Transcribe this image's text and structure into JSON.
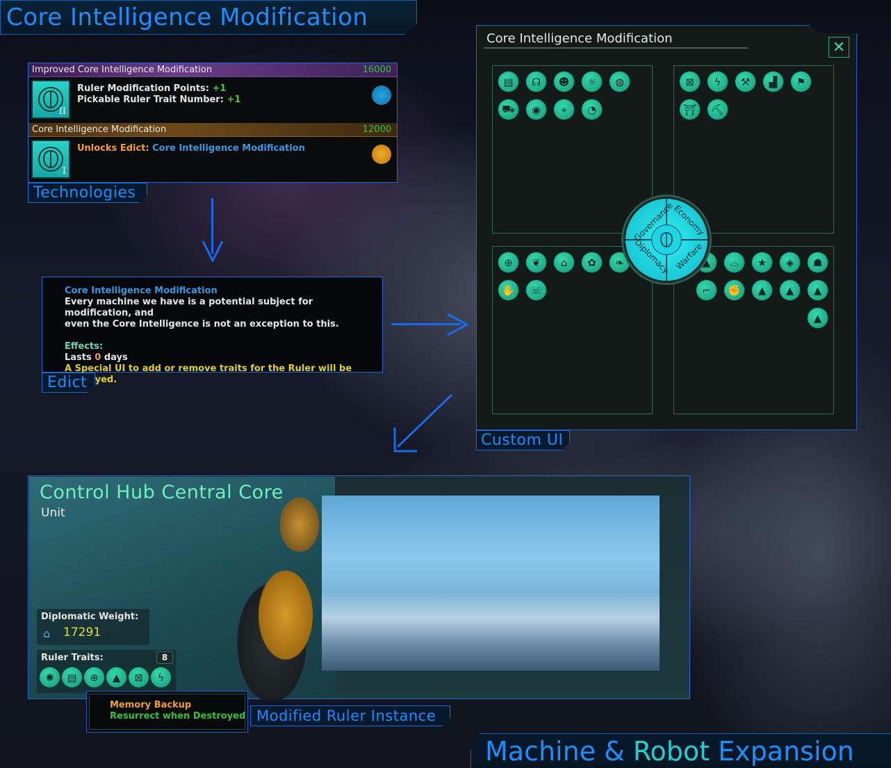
{
  "main_title": "Core Intelligence Modification",
  "technologies": {
    "section_label": "Technologies",
    "items": [
      {
        "name": "Improved Core Intelligence Modification",
        "cost": "16000",
        "tier": "II",
        "effects": [
          {
            "label": "Ruler Modification Points:",
            "value": "+1"
          },
          {
            "label": "Pickable Ruler Trait Number:",
            "value": "+1"
          }
        ],
        "category_icon": "computer-icon",
        "category_color": "#1e8fd0"
      },
      {
        "name": "Core Intelligence Modification",
        "cost": "12000",
        "tier": "I",
        "unlock_label": "Unlocks Edict:",
        "unlock_value": "Core Intelligence Modification",
        "category_icon": "factory-icon",
        "category_color": "#e09a1a"
      }
    ]
  },
  "edict": {
    "section_label": "Edict",
    "title": "Core Intelligence Modification",
    "description_line1": "Every machine we have is a potential subject for modification, and",
    "description_line2": "even the Core Intelligence is not an exception to this.",
    "effects_label": "Effects:",
    "lasts_prefix": "Lasts",
    "lasts_value": "0",
    "lasts_suffix": "days",
    "special_note": "A Special UI to add or remove traits for the Ruler will be displayed."
  },
  "custom_ui": {
    "section_label": "Custom UI",
    "window_title": "Core Intelligence Modification",
    "close_label": "✕",
    "wheel": {
      "governance": "Governance",
      "economy": "Economy",
      "diplomacy": "Diplomacy",
      "warfare": "Warfare"
    },
    "governance_traits": [
      "memory-card-icon",
      "broadcaster-icon",
      "crowd-icon",
      "idea-icon",
      "globe-icon",
      "ore-cart-icon",
      "eye-icon",
      "telescope-icon",
      "gauge-icon"
    ],
    "economy_traits": [
      "construction-icon",
      "energy-icon",
      "pickaxe-icon",
      "factory-icon",
      "flag-planet-icon",
      "tower-icon",
      "mine-cart-icon"
    ],
    "diplomacy_traits": [
      "world-icon",
      "laurel-planet-icon",
      "laurel-bank-icon",
      "laurel-alliance-icon",
      "laurel-fleet-icon",
      "handshake-icon",
      "envoy-icon"
    ],
    "warfare_traits": [
      "fleet-repair-icon",
      "bunker-icon",
      "medal-icon",
      "shield-cube-icon",
      "admiral-icon",
      "boot-icon",
      "fist-icon",
      "ship-1-icon",
      "ship-2-icon",
      "ship-3-icon",
      "ship-4-icon"
    ]
  },
  "ruler_card": {
    "section_label": "Modified Ruler Instance",
    "name": "Control Hub Central Core",
    "type": "Unit",
    "diplomatic_weight_label": "Diplomatic Weight:",
    "diplomatic_weight_value": "17291",
    "ruler_traits_label": "Ruler Traits:",
    "ruler_traits_count": "8",
    "traits": [
      "brain-icon",
      "memory-card-icon",
      "world-icon",
      "fleet-repair-icon",
      "construction-icon",
      "energy-icon"
    ],
    "tooltip_title": "Memory Backup",
    "tooltip_effect": "Resurrect when Destroyed"
  },
  "footer": {
    "part1": "Machine & ",
    "part2": "Robot",
    "part3": " Expansion"
  },
  "glyphs": {
    "memory-card-icon": "▤",
    "broadcaster-icon": "☊",
    "crowd-icon": "☻",
    "idea-icon": "☼",
    "globe-icon": "◍",
    "ore-cart-icon": "⛟",
    "eye-icon": "◉",
    "telescope-icon": "⌖",
    "gauge-icon": "◔",
    "construction-icon": "⊠",
    "energy-icon": "ϟ",
    "pickaxe-icon": "⚒",
    "factory-icon": "▟",
    "flag-planet-icon": "⚑",
    "tower-icon": "⛩",
    "mine-cart-icon": "⛏",
    "world-icon": "⊕",
    "laurel-planet-icon": "❦",
    "laurel-bank-icon": "⌂",
    "laurel-alliance-icon": "✿",
    "laurel-fleet-icon": "❧",
    "handshake-icon": "✋",
    "envoy-icon": "☏",
    "fleet-repair-icon": "▲",
    "bunker-icon": "⌓",
    "medal-icon": "★",
    "shield-cube-icon": "◈",
    "admiral-icon": "☗",
    "boot-icon": "⌐",
    "fist-icon": "✊",
    "ship-1-icon": "▲",
    "ship-2-icon": "▲",
    "ship-3-icon": "▲",
    "ship-4-icon": "▲",
    "brain-icon": "✺"
  },
  "colors": {
    "accent_blue": "#1a8cff",
    "trait_teal": "#1fb893",
    "positive_green": "#3fcc3f",
    "highlight_orange": "#f0a030",
    "note_yellow": "#e1d02a",
    "link_blue": "#3a98e0",
    "ruler_name": "#6ef0c0"
  }
}
